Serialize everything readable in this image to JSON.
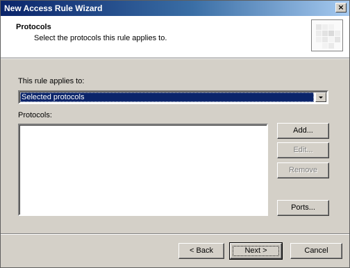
{
  "window": {
    "title": "New Access Rule Wizard",
    "close_glyph": "×"
  },
  "header": {
    "title": "Protocols",
    "subtitle": "Select the protocols this rule applies to.",
    "graphic_icon": "wizard-grid-icon"
  },
  "applies_to": {
    "label": "This rule applies to:",
    "selected": "Selected protocols"
  },
  "protocols": {
    "label": "Protocols:",
    "items": []
  },
  "side_buttons": {
    "add": "Add...",
    "edit": "Edit...",
    "remove": "Remove",
    "ports": "Ports..."
  },
  "footer": {
    "back": "< Back",
    "next": "Next >",
    "cancel": "Cancel"
  },
  "colors": {
    "title_gradient_start": "#0a246a",
    "title_gradient_end": "#a6caf0",
    "selection": "#0a246a",
    "face": "#d4d0c8",
    "disabled_text": "#808080"
  }
}
